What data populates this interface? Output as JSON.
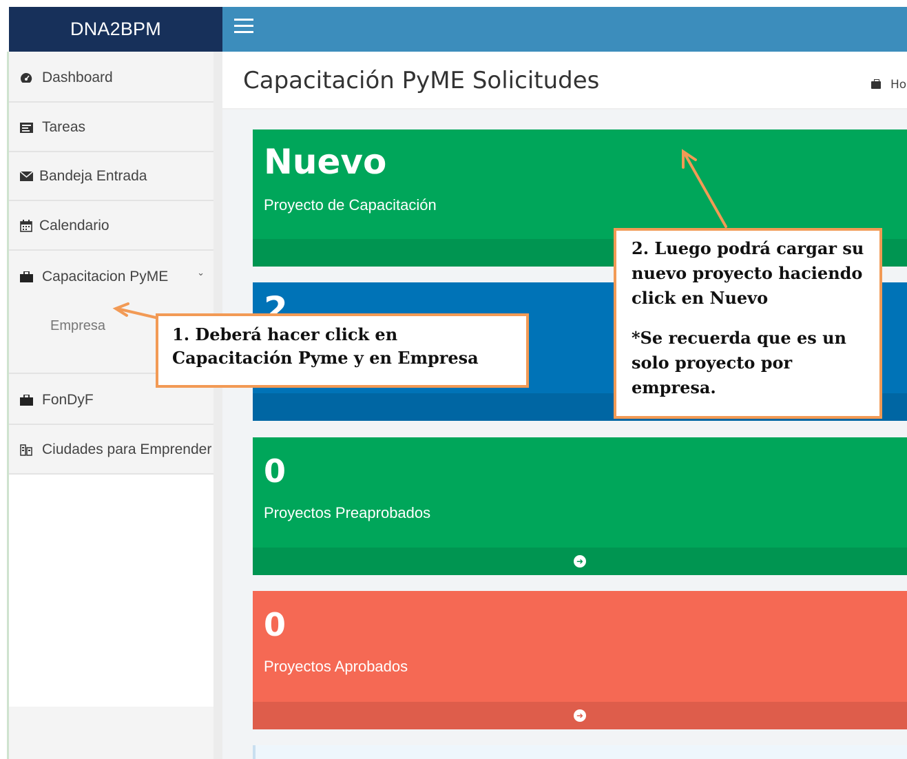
{
  "header": {
    "logo": "DNA2BPM"
  },
  "sidebar": {
    "items": [
      {
        "label": "Dashboard",
        "icon": "dashboard-icon"
      },
      {
        "label": "Tareas",
        "icon": "tasks-icon"
      },
      {
        "label": "Bandeja Entrada",
        "icon": "envelope-icon"
      },
      {
        "label": "Calendario",
        "icon": "calendar-icon"
      },
      {
        "label": "Capacitacion PyME",
        "icon": "briefcase-icon"
      },
      {
        "label": "FonDyF",
        "icon": "briefcase-icon"
      },
      {
        "label": "Ciudades para Emprender",
        "icon": "city-icon"
      }
    ],
    "submenu": [
      "Empresa"
    ]
  },
  "content": {
    "title": "Capacitación PyME Solicitudes",
    "breadcrumb": "Ho",
    "boxes": [
      {
        "value": "Nuevo",
        "label": "Proyecto de Capacitación",
        "color": "#00a65a"
      },
      {
        "value": "2",
        "label": "",
        "color": "#0073b7"
      },
      {
        "value": "0",
        "label": "Proyectos Preaprobados",
        "color": "#00a65a"
      },
      {
        "value": "0",
        "label": "Proyectos Aprobados",
        "color": "#f56954"
      }
    ]
  },
  "callouts": {
    "step1": "1. Deberá hacer click en Capacitación Pyme y en Empresa",
    "step2": "2. Luego podrá  cargar su nuevo proyecto haciendo click en Nuevo",
    "note": "*Se recuerda que es un solo proyecto por empresa."
  },
  "colors": {
    "topbar": "#3c8dbc",
    "logo_bg": "#17305a",
    "callout_border": "#f29a55",
    "arrow": "#f29a55"
  }
}
